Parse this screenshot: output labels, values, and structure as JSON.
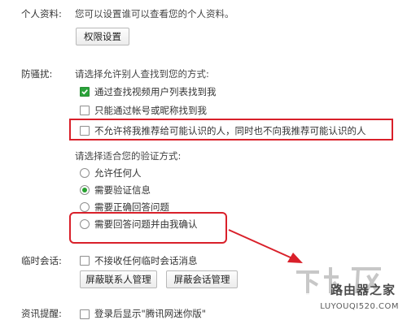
{
  "profile": {
    "label": "个人资料:",
    "desc": "您可以设置谁可以查看您的个人资料。",
    "permission_button": "权限设置"
  },
  "anti_harass": {
    "label": "防骚扰:",
    "find_prompt": "请选择允许别人查找到您的方式:",
    "find_options": [
      {
        "label": "通过查找视频用户列表找到我",
        "checked": true
      },
      {
        "label": "只能通过帐号或昵称找到我",
        "checked": false
      },
      {
        "label": "不允许将我推荐给可能认识的人，同时也不向我推荐可能认识的人",
        "checked": false
      }
    ],
    "verify_prompt": "请选择适合您的验证方式:",
    "verify_options": [
      {
        "label": "允许任何人",
        "selected": false
      },
      {
        "label": "需要验证信息",
        "selected": true
      },
      {
        "label": "需要正确回答问题",
        "selected": false
      },
      {
        "label": "需要回答问题并由我确认",
        "selected": false
      }
    ]
  },
  "temp_chat": {
    "label": "临时会话:",
    "option": "不接收任何临时会话消息",
    "button_block_contacts": "屏蔽联系人管理",
    "button_block_sessions": "屏蔽会话管理"
  },
  "news": {
    "label": "资讯提醒:",
    "option": "登录后显示\"腾讯网迷你版\""
  },
  "watermark": {
    "site_name": "路由器之家",
    "url": "LUYOUQI520.COM"
  },
  "colors": {
    "highlight": "#d9202a",
    "check_green": "#2aa33a"
  }
}
